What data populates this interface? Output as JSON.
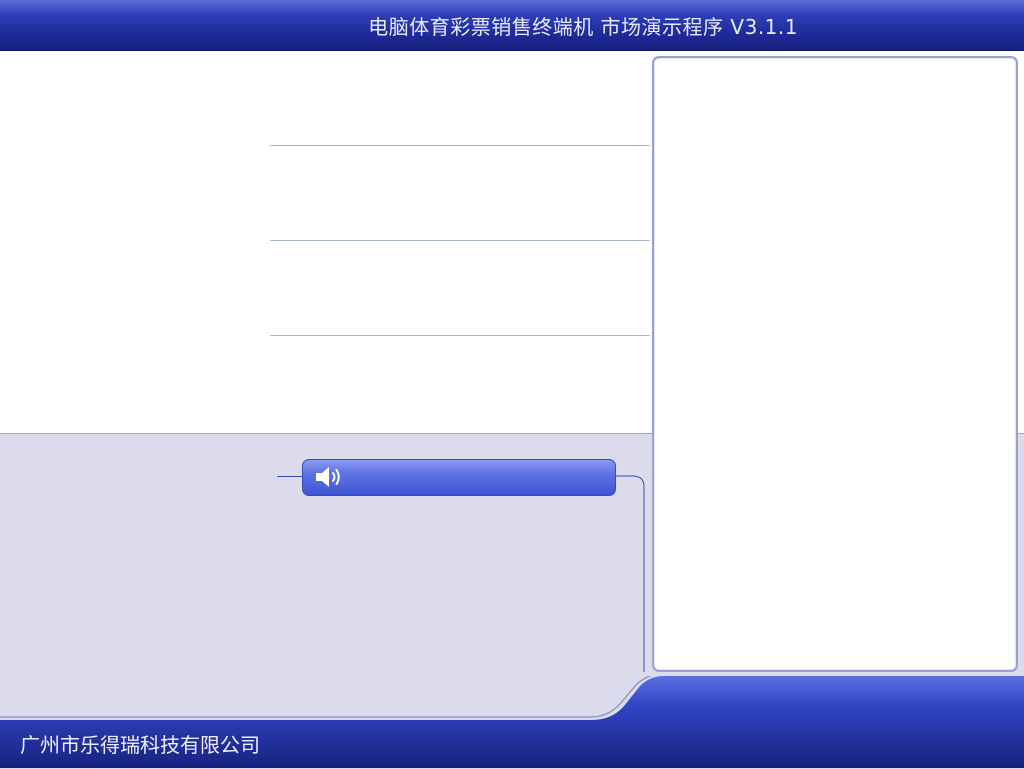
{
  "header": {
    "title": "电脑体育彩票销售终端机  市场演示程序  V3.1.1"
  },
  "audio": {
    "icon": "speaker-icon"
  },
  "footer": {
    "company": "广州市乐得瑞科技有限公司"
  },
  "colors": {
    "header_blue": "#1e2a98",
    "panel_border": "#9aa0d4",
    "lower_background": "#dcdbeb",
    "accent_blue": "#3e55d3"
  }
}
